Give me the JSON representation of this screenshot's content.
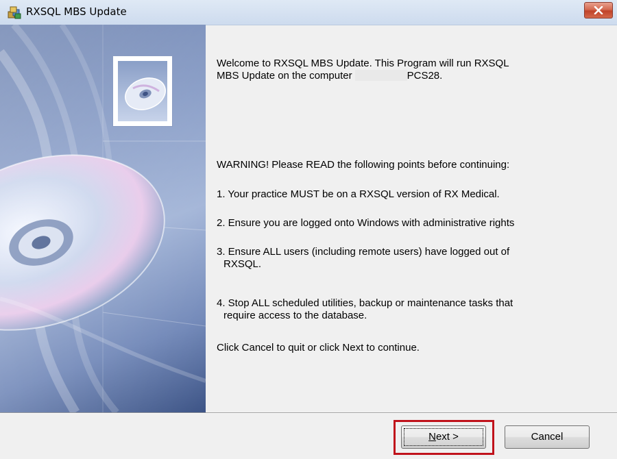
{
  "window": {
    "title": "RXSQL MBS Update"
  },
  "icons": {
    "app": "installer-package-icon",
    "close": "close-icon",
    "banner": "cd-disc-image",
    "thumb": "cd-disc-icon"
  },
  "content": {
    "welcome_line1": "Welcome to RXSQL MBS Update.  This Program will run RXSQL",
    "welcome_line2_prefix": "MBS Update on the computer",
    "welcome_line2_suffix": "PCS28.",
    "warning": "WARNING! Please READ the following points before continuing:",
    "point1": "1. Your practice MUST be on a RXSQL version of RX Medical.",
    "point2": "2. Ensure you are logged onto Windows with administrative rights",
    "point3_line1": "3. Ensure ALL users (including remote users) have logged out of",
    "point3_line2": "RXSQL.",
    "point4_line1": "4. Stop ALL scheduled utilities, backup or maintenance tasks that",
    "point4_line2": "require access to the database.",
    "instruction": "Click Cancel to quit or click Next to continue."
  },
  "buttons": {
    "next_mnemonic": "N",
    "next_rest": "ext >",
    "cancel": "Cancel"
  },
  "colors": {
    "highlight": "#c0121b",
    "close_button": "#c8472e"
  }
}
